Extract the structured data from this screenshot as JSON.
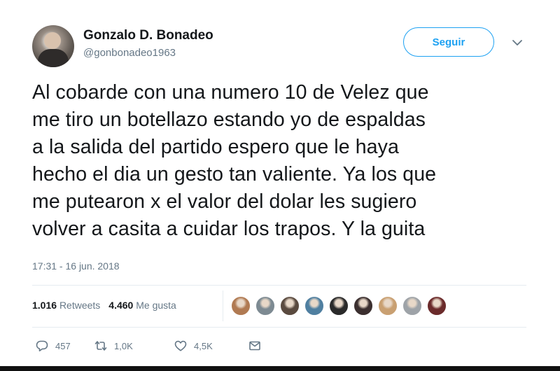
{
  "author": {
    "name": "Gonzalo D. Bonadeo",
    "handle": "@gonbonadeo1963"
  },
  "follow_button": {
    "label": "Seguir"
  },
  "tweet": {
    "text": "Al cobarde con una numero 10 de Velez que\nme tiro un botellazo estando yo de espaldas\na la salida del partido espero que le haya\nhecho el dia un gesto tan valiente. Ya los que\nme putearon x el valor del dolar les sugiero\nvolver a casita a cuidar los trapos. Y la guita",
    "timestamp": "17:31 - 16 jun. 2018"
  },
  "stats": {
    "retweets_count": "1.016",
    "retweets_label": "Retweets",
    "likes_count": "4.460",
    "likes_label": "Me gusta"
  },
  "likers": [
    {
      "color": "#b07a52"
    },
    {
      "color": "#7d8a92"
    },
    {
      "color": "#5a4a3f"
    },
    {
      "color": "#4f7fa0"
    },
    {
      "color": "#2a2a2a"
    },
    {
      "color": "#3b2f2f"
    },
    {
      "color": "#c9a072"
    },
    {
      "color": "#9ea3a8"
    },
    {
      "color": "#6b2b2b"
    }
  ],
  "actions": {
    "reply_count": "457",
    "retweet_count": "1,0K",
    "like_count": "4,5K"
  },
  "colors": {
    "accent": "#1da1f2",
    "secondary_text": "#657786"
  }
}
